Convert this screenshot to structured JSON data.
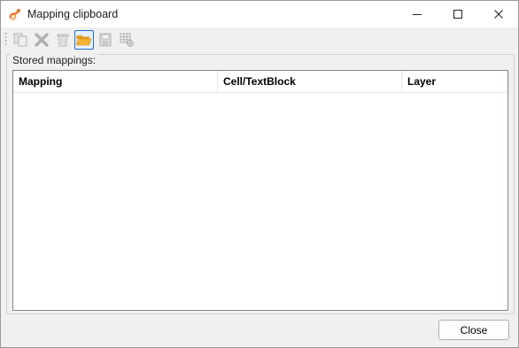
{
  "window": {
    "title": "Mapping clipboard"
  },
  "titlebar_buttons": {
    "minimize": "minimize-icon",
    "maximize": "maximize-icon",
    "close": "close-icon"
  },
  "toolbar": {
    "items": [
      {
        "name": "copy-icon",
        "enabled": false
      },
      {
        "name": "delete-icon",
        "enabled": false
      },
      {
        "name": "recycle-bin-icon",
        "enabled": false
      },
      {
        "name": "open-folder-icon",
        "enabled": true,
        "active": true
      },
      {
        "name": "save-icon",
        "enabled": false
      },
      {
        "name": "table-settings-icon",
        "enabled": false
      }
    ]
  },
  "group": {
    "label": "Stored mappings:"
  },
  "list": {
    "columns": [
      "Mapping",
      "Cell/TextBlock",
      "Layer"
    ],
    "rows": []
  },
  "footer": {
    "close_label": "Close"
  },
  "colors": {
    "accent": "#1e6fd9",
    "folder": "#f4b431"
  }
}
